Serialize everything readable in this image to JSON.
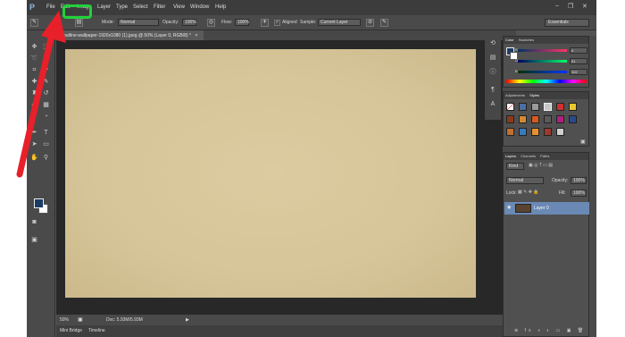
{
  "menubar": {
    "logo": "P",
    "items": [
      "File",
      "Edit",
      "Image",
      "Layer",
      "Type",
      "Select",
      "Filter",
      "View",
      "Window",
      "Help"
    ],
    "window_controls": [
      "–",
      "❐",
      "✕"
    ]
  },
  "options_bar": {
    "mode_label": "Mode:",
    "mode_value": "Normal",
    "opacity_label": "Opacity:",
    "opacity_value": "100%",
    "flow_label": "Flow:",
    "flow_value": "100%",
    "aligned_label": "Aligned",
    "sample_label": "Sample:",
    "sample_value": "Current Layer",
    "workspace_value": "Essentials"
  },
  "document_tab": {
    "title": "outline-wallpaper-1920x1080 (1).jpeg @ 50% (Layer 0, RGB/8) *",
    "close": "×"
  },
  "status": {
    "zoom": "50%",
    "doc_info": "Doc: 5.93M/5.93M"
  },
  "bottom_tabs": [
    "Mini Bridge",
    "Timeline"
  ],
  "color_panel": {
    "tabs": [
      "Color",
      "Swatches"
    ],
    "r_label": "R",
    "r_value": "0",
    "g_label": "G",
    "g_value": "51",
    "b_label": "B",
    "b_value": "102"
  },
  "adjustments_panel": {
    "tabs": [
      "Adjustments",
      "Styles"
    ]
  },
  "layers_panel": {
    "tabs": [
      "Layers",
      "Channels",
      "Paths"
    ],
    "kind_value": "Kind",
    "blend_value": "Normal",
    "opacity_label": "Opacity:",
    "opacity_value": "100%",
    "lock_label": "Lock:",
    "fill_label": "Fill:",
    "fill_value": "100%",
    "layer_name": "Layer 0"
  },
  "colors": {
    "annotation_green": "#22d13a",
    "annotation_red": "#e8202a",
    "foreground": "#1a3b64",
    "background": "#ffffff",
    "canvas": "#d6c598",
    "app_bg": "#535353"
  }
}
